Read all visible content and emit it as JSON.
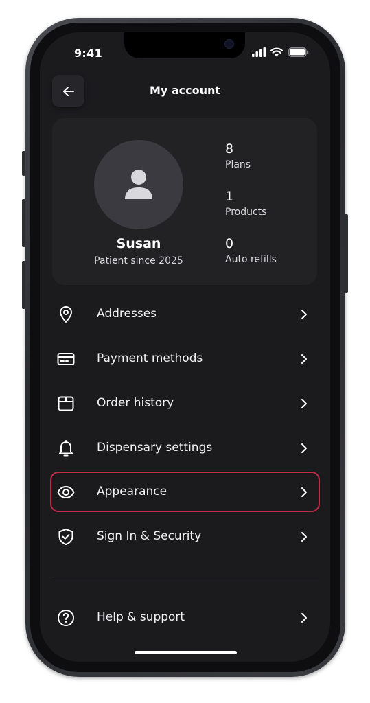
{
  "status_bar": {
    "time": "9:41"
  },
  "header": {
    "title": "My account"
  },
  "profile": {
    "name": "Susan",
    "since": "Patient since 2025",
    "stats": [
      {
        "value": "8",
        "label": "Plans"
      },
      {
        "value": "1",
        "label": "Products"
      },
      {
        "value": "0",
        "label": "Auto refills"
      }
    ]
  },
  "menu": {
    "items": [
      {
        "label": "Addresses",
        "icon": "location-pin-icon"
      },
      {
        "label": "Payment methods",
        "icon": "credit-card-icon"
      },
      {
        "label": "Order history",
        "icon": "box-icon"
      },
      {
        "label": "Dispensary settings",
        "icon": "bell-icon"
      },
      {
        "label": "Appearance",
        "icon": "eye-icon",
        "highlighted": true
      },
      {
        "label": "Sign In & Security",
        "icon": "shield-check-icon"
      }
    ],
    "footer_items": [
      {
        "label": "Help & support",
        "icon": "question-circle-icon"
      }
    ]
  },
  "colors": {
    "background": "#1b1b1e",
    "card": "#222225",
    "highlight_border": "#c02c4a",
    "text": "#ffffff"
  }
}
